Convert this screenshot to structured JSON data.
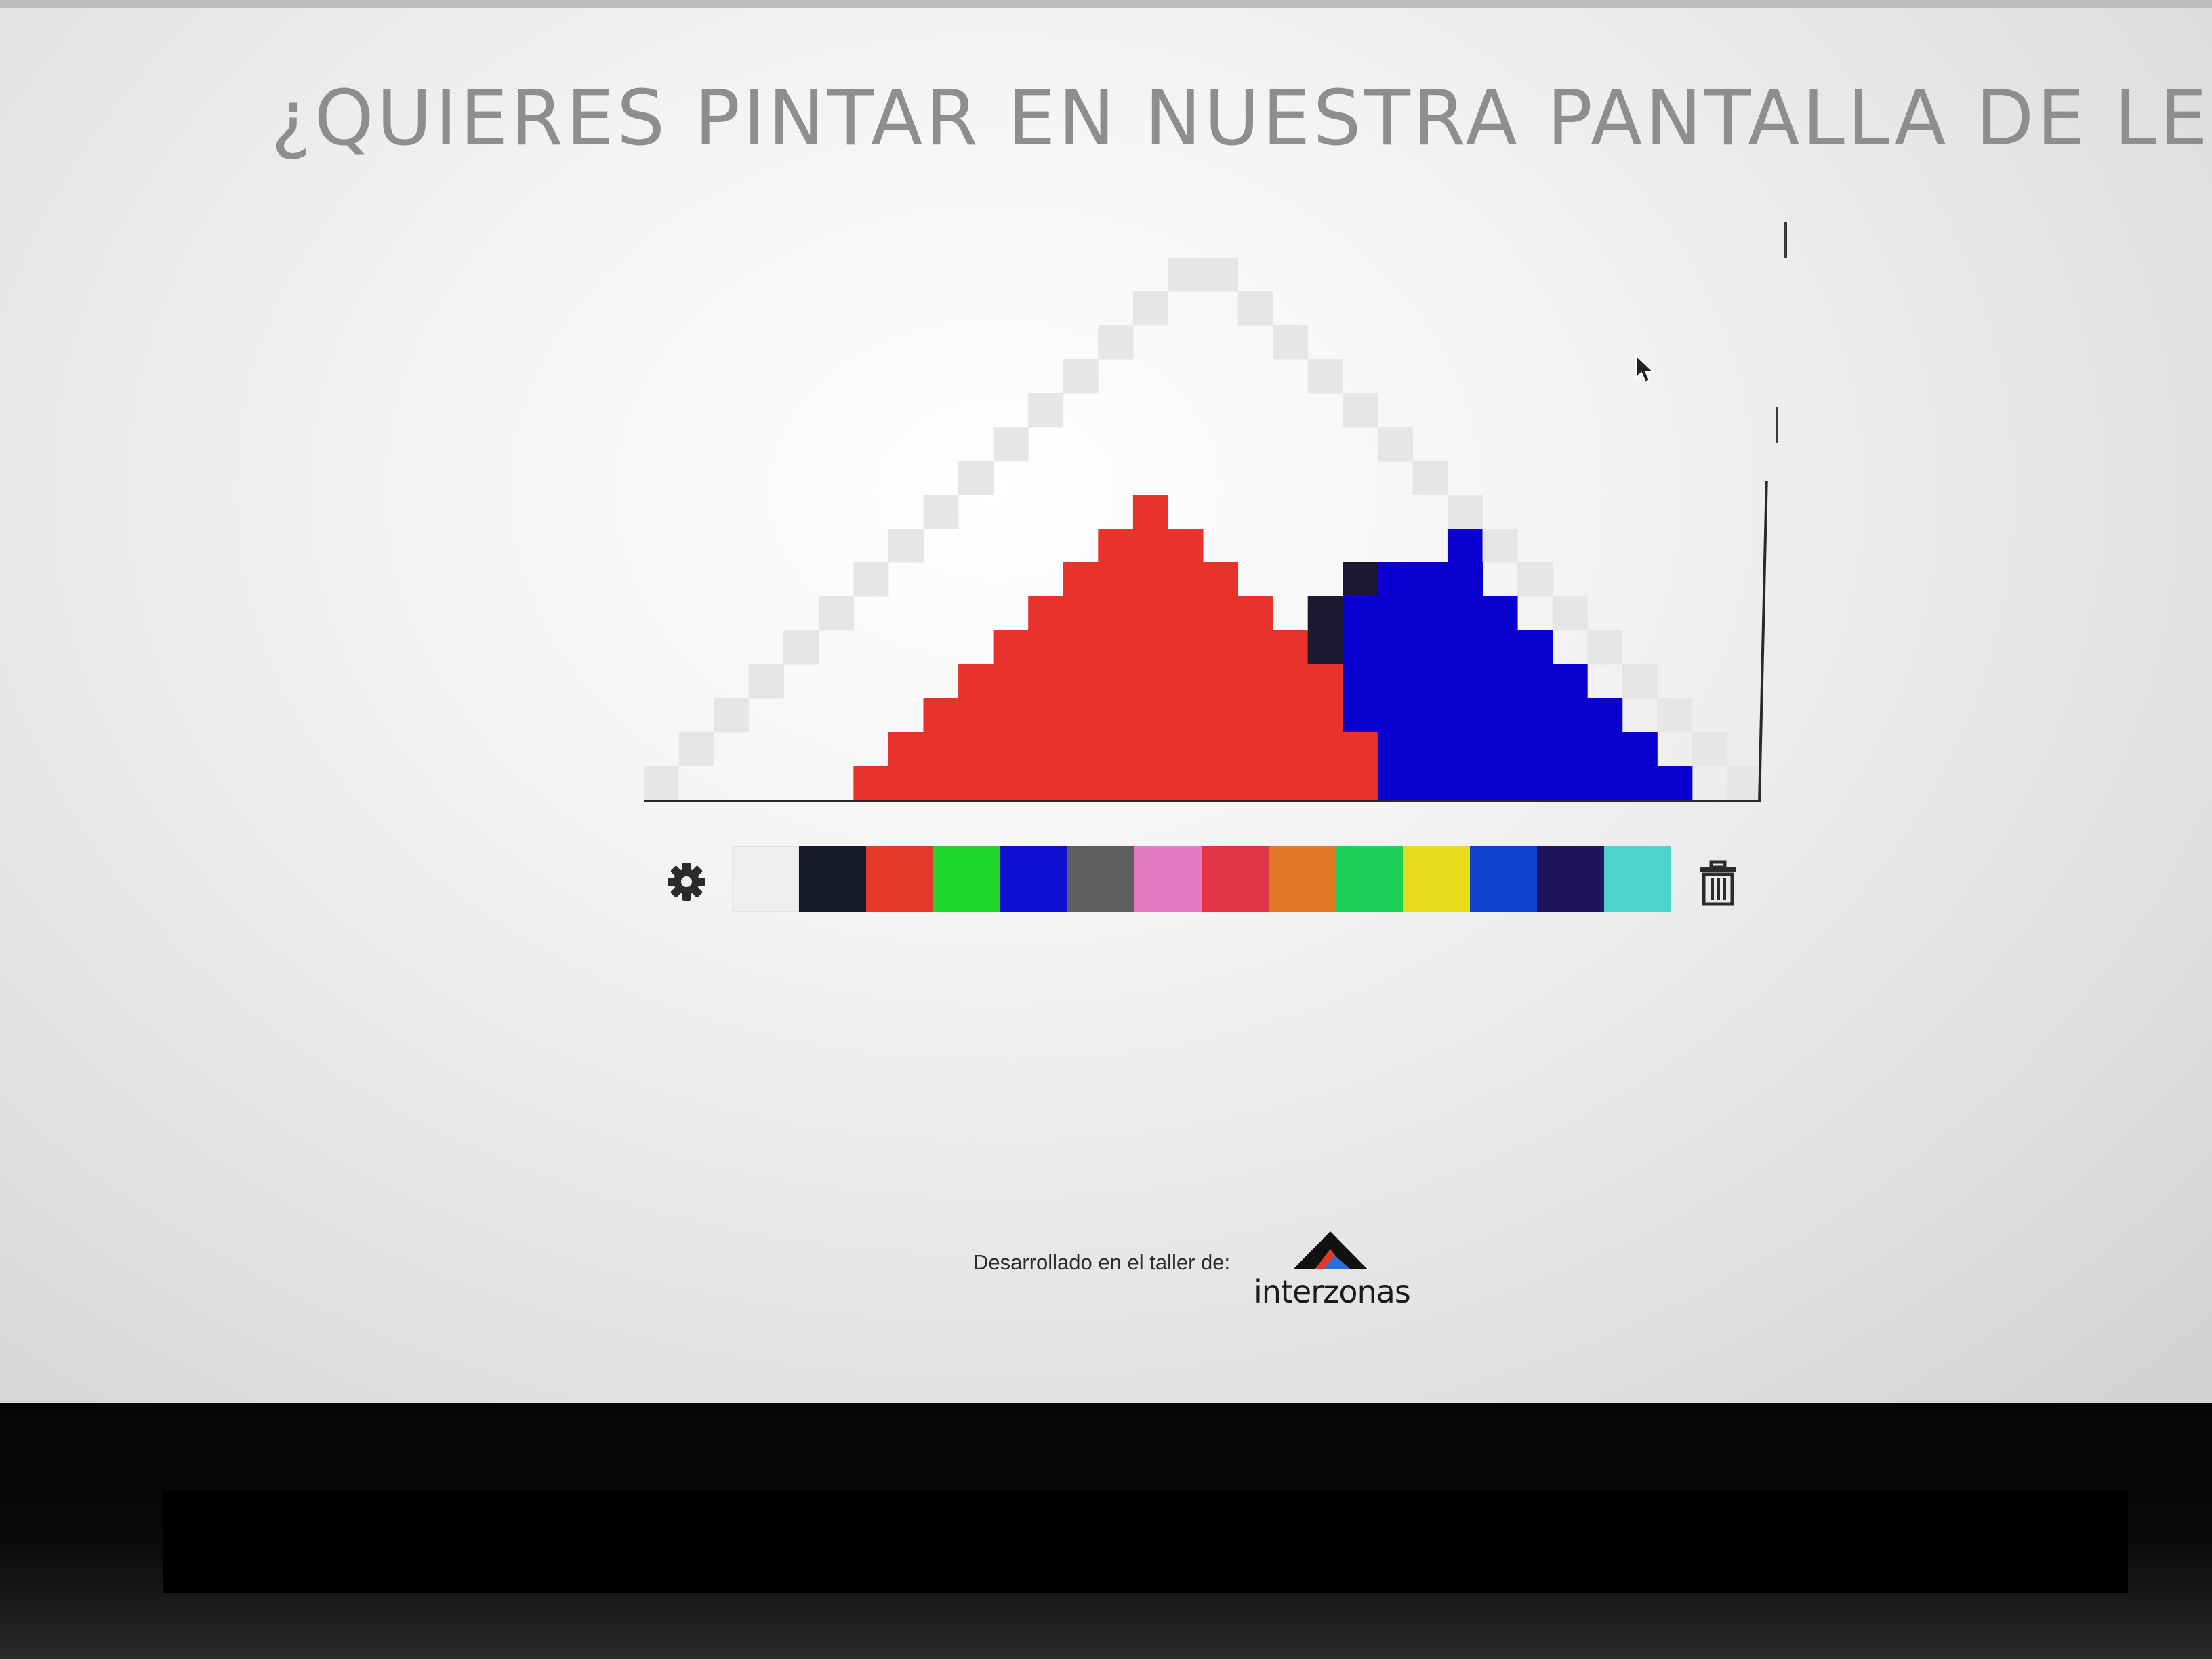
{
  "header": {
    "title": "¿QUIERES PINTAR EN NUESTRA PANTALLA DE LEDS?"
  },
  "led_board": {
    "rows": 17,
    "cols": 32,
    "background": "#ffffff",
    "palette_map": {
      "W": "#e6e6e6",
      "R": "#e8322b",
      "B": "#0a00d0",
      "K": "#1c1a33"
    },
    "pixels": [
      "................................",
      "...............WW...............",
      "..............W..W..............",
      ".............W....W.............",
      "............W......W............",
      "...........W........W...........",
      "..........W..........W..........",
      ".........W............W.........",
      "........W.....R........W........",
      ".......W.....RRR.......BW.......",
      "......W.....RRRRR...KBBB.W......",
      ".....W.....RRRRRRR.KBBBBB.W.....",
      "....W.....RRRRRRRRRKBBBBBB.W....",
      "...W.....RRRRRRRRRRRBBBBBBB.W...",
      "..W.....RRRRRRRRRRRRBBBBBBBB.W..",
      ".W.....RRRRRRRRRRRRRRBBBBBBBB.W.",
      "W.....RRRRRRRRRRRRRRRBBBBBBBBB.W"
    ]
  },
  "toolbar": {
    "settings_icon": "gear-icon",
    "delete_icon": "trash-icon",
    "palette": [
      "#efefef",
      "#161a26",
      "#e2392b",
      "#1fd62a",
      "#0e0fd0",
      "#5e5e5e",
      "#e37ac4",
      "#e23447",
      "#e27726",
      "#1ecf58",
      "#e6dc1e",
      "#0f43cf",
      "#20155a",
      "#4ed3cc"
    ]
  },
  "footer": {
    "credit_text": "Desarrollado en el taller de:",
    "logo_text": "interzonas"
  }
}
